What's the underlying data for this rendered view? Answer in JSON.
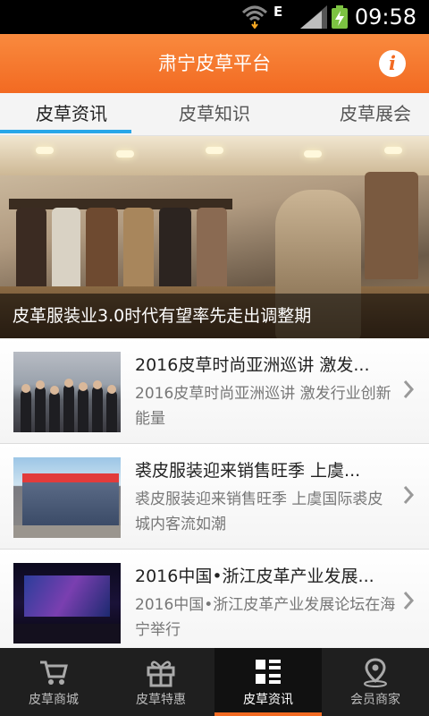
{
  "status_bar": {
    "time": "09:58",
    "network_type": "E"
  },
  "header": {
    "title": "肃宁皮草平台",
    "info_icon": "info-icon",
    "brand_color": "#f26a22"
  },
  "tabs": [
    {
      "label": "皮草资讯",
      "active": true
    },
    {
      "label": "皮草知识",
      "active": false
    },
    {
      "label": "皮草展会",
      "active": false
    }
  ],
  "banner": {
    "caption": "皮革服装业3.0时代有望率先走出调整期"
  },
  "news": [
    {
      "title": "2016皮草时尚亚洲巡讲 激发...",
      "summary": "2016皮草时尚亚洲巡讲 激发行业创新能量"
    },
    {
      "title": "裘皮服装迎来销售旺季 上虞...",
      "summary": "裘皮服装迎来销售旺季 上虞国际裘皮城内客流如潮"
    },
    {
      "title": "2016中国•浙江皮革产业发展...",
      "summary": "2016中国•浙江皮革产业发展论坛在海宁举行"
    }
  ],
  "bottom_nav": [
    {
      "label": "皮草商城",
      "icon": "cart-icon",
      "active": false
    },
    {
      "label": "皮草特惠",
      "icon": "gift-icon",
      "active": false
    },
    {
      "label": "皮草资讯",
      "icon": "grid-list-icon",
      "active": true
    },
    {
      "label": "会员商家",
      "icon": "location-pin-icon",
      "active": false
    }
  ],
  "colors": {
    "accent": "#f26a22",
    "tab_indicator": "#29a6e8",
    "bottom_nav_bg": "#1f1f1f"
  }
}
